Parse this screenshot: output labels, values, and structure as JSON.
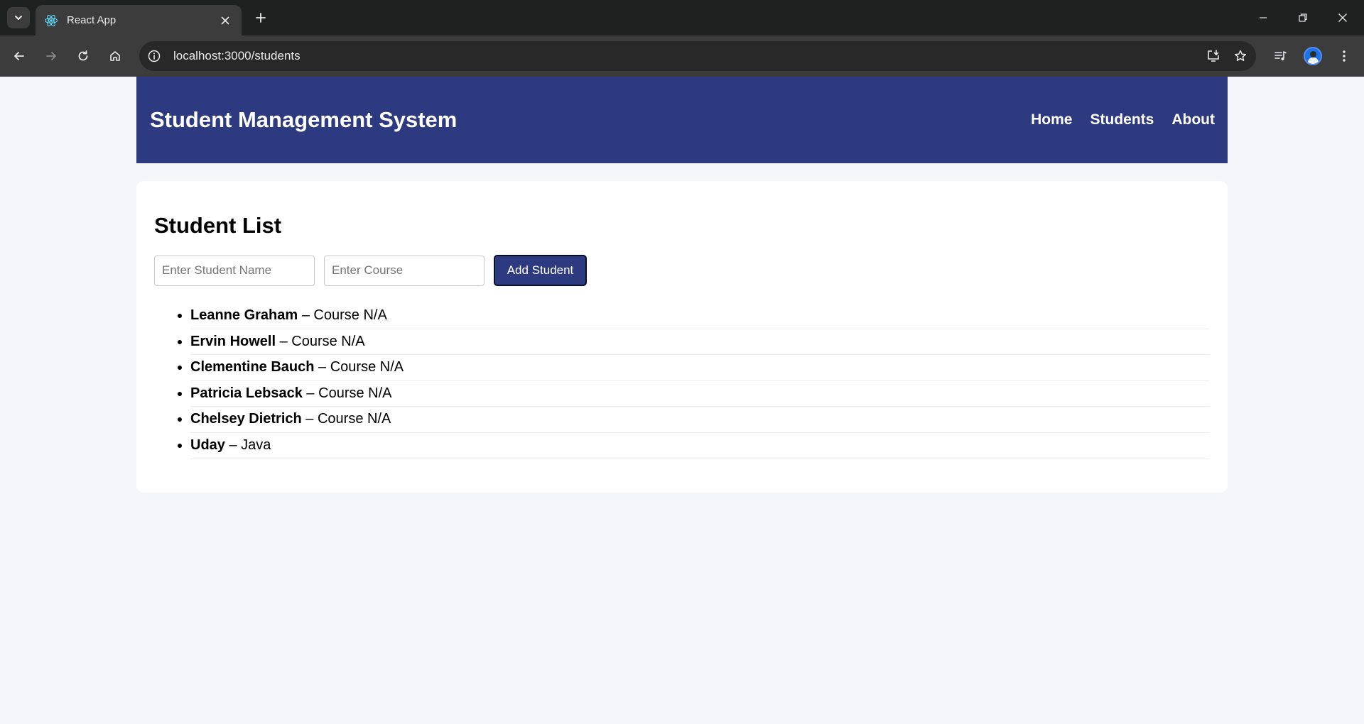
{
  "browser": {
    "tab_title": "React App",
    "url": "localhost:3000/students"
  },
  "header": {
    "title": "Student Management System",
    "nav": [
      "Home",
      "Students",
      "About"
    ]
  },
  "student_list": {
    "heading": "Student List",
    "name_placeholder": "Enter Student Name",
    "course_placeholder": "Enter Course",
    "add_button": "Add Student",
    "separator": " – ",
    "students": [
      {
        "name": "Leanne Graham",
        "course": "Course N/A"
      },
      {
        "name": "Ervin Howell",
        "course": "Course N/A"
      },
      {
        "name": "Clementine Bauch",
        "course": "Course N/A"
      },
      {
        "name": "Patricia Lebsack",
        "course": "Course N/A"
      },
      {
        "name": "Chelsey Dietrich",
        "course": "Course N/A"
      },
      {
        "name": "Uday",
        "course": "Java"
      }
    ]
  },
  "colors": {
    "brand": "#2e3a80",
    "page_bg": "#f5f6fa"
  }
}
